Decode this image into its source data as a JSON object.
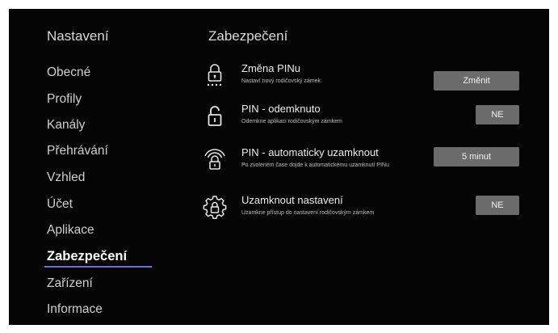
{
  "sidebar": {
    "title": "Nastavení",
    "items": [
      {
        "label": "Obecné"
      },
      {
        "label": "Profily"
      },
      {
        "label": "Kanály"
      },
      {
        "label": "Přehrávání"
      },
      {
        "label": "Vzhled"
      },
      {
        "label": "Účet"
      },
      {
        "label": "Aplikace"
      },
      {
        "label": "Zabezpečení",
        "active": true
      },
      {
        "label": "Zařízení"
      },
      {
        "label": "Informace"
      }
    ]
  },
  "main": {
    "title": "Zabezpečení",
    "rows": [
      {
        "icon": "pin-lock-icon",
        "title": "Změna PINu",
        "description": "Nastaví nový rodičovský zámek",
        "button": "Změnit"
      },
      {
        "icon": "unlock-icon",
        "title": "PIN - odemknuto",
        "description": "Odemkne aplikaci rodičovským zámkem",
        "button": "NE"
      },
      {
        "icon": "auto-lock-icon",
        "title": "PIN - automaticky uzamknout",
        "description": "Po zvoleném čase dojde k automatickému uzamknutí PINu",
        "button": "5 minut"
      },
      {
        "icon": "settings-lock-icon",
        "title": "Uzamknout nastavení",
        "description": "Uzamkne přístup do nastavení rodičovským zámkem",
        "button": "NE"
      }
    ]
  },
  "colors": {
    "background": "#050505",
    "button": "#6b6b6b",
    "accent": "#6c6fd6"
  }
}
